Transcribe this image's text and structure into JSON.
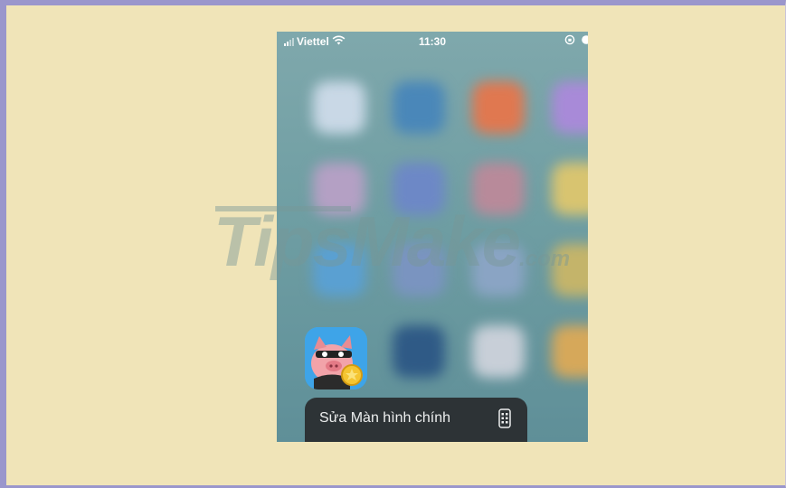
{
  "status_bar": {
    "carrier": "Viettel",
    "time": "11:30",
    "icons": [
      "signal-icon",
      "wifi-icon",
      "orientation-lock-icon",
      "alarm-icon"
    ]
  },
  "watermark": {
    "brand": "TipsMake",
    "domain": ".com"
  },
  "app": {
    "icon": "pig-game-app-icon"
  },
  "context_menu": {
    "items": [
      {
        "label": "Sửa Màn hình chính",
        "icon": "phone-screen-icon"
      }
    ]
  },
  "colors": {
    "page_background": "#f0e4b8",
    "frame_border": "#9a96cc",
    "menu_background": "#2d3336",
    "app_icon_background": "#3ea4e8"
  }
}
